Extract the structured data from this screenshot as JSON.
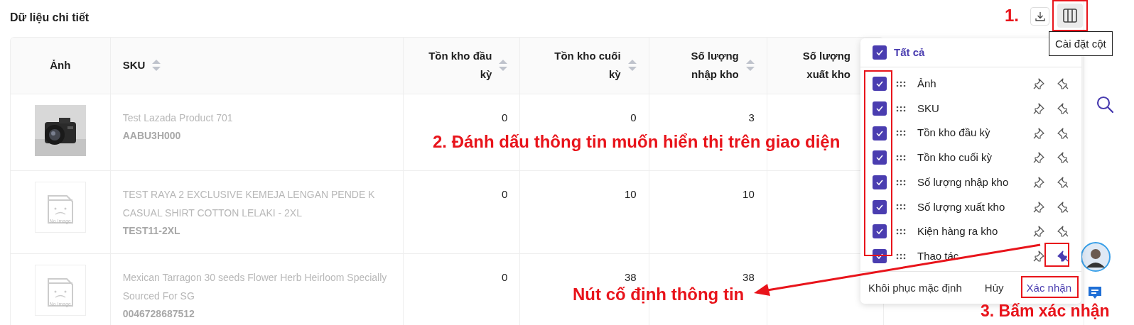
{
  "title": "Dữ liệu chi tiết",
  "tooltip": "Cài đặt cột",
  "table": {
    "columns": [
      {
        "label": "Ảnh",
        "sortable": false
      },
      {
        "label": "SKU",
        "sortable": true
      },
      {
        "label": "Tồn kho đầu kỳ",
        "sortable": true
      },
      {
        "label": "Tồn kho cuối kỳ",
        "sortable": true
      },
      {
        "label": "Số lượng nhập kho",
        "sortable": true
      },
      {
        "label": "Số lượng xuất kho",
        "sortable": false
      }
    ],
    "rows": [
      {
        "name": "Test Lazada Product 701",
        "sku": "AABU3H000",
        "opening_stock": "0",
        "closing_stock": "0",
        "stock_in": "3"
      },
      {
        "image": {
          "kind": "placeholder",
          "label": "No Image"
        },
        "name": "TEST RAYA 2 EXCLUSIVE KEMEJA LENGAN PENDE K CASUAL SHIRT COTTON LELAKI - 2XL",
        "sku": "TEST11-2XL",
        "opening_stock": "0",
        "closing_stock": "10",
        "stock_in": "10"
      },
      {
        "image": {
          "kind": "placeholder",
          "label": "No Image"
        },
        "name": "Mexican Tarragon 30 seeds Flower Herb Heirloom Specially Sourced For SG",
        "sku": "0046728687512",
        "opening_stock": "0",
        "closing_stock": "38",
        "stock_in": "38"
      }
    ]
  },
  "column_settings": {
    "select_all": {
      "label": "Tất cả",
      "checked": true
    },
    "items": [
      {
        "label": "Ảnh",
        "checked": true,
        "pinned_left": false,
        "pinned_right": false
      },
      {
        "label": "SKU",
        "checked": true,
        "pinned_left": false,
        "pinned_right": false
      },
      {
        "label": "Tồn kho đầu kỳ",
        "checked": true,
        "pinned_left": false,
        "pinned_right": false
      },
      {
        "label": "Tồn kho cuối kỳ",
        "checked": true,
        "pinned_left": false,
        "pinned_right": false
      },
      {
        "label": "Số lượng nhập kho",
        "checked": true,
        "pinned_left": false,
        "pinned_right": false
      },
      {
        "label": "Số lượng xuất kho",
        "checked": true,
        "pinned_left": false,
        "pinned_right": false
      },
      {
        "label": "Kiện hàng ra kho",
        "checked": true,
        "pinned_left": false,
        "pinned_right": false
      },
      {
        "label": "Thao tác",
        "checked": true,
        "pinned_left": false,
        "pinned_right": true
      }
    ],
    "buttons": [
      {
        "label": "Khôi phục mặc định",
        "kind": "plain"
      },
      {
        "label": "Hủy",
        "kind": "plain"
      },
      {
        "label": "Xác nhận",
        "kind": "primary"
      }
    ]
  },
  "annotations": [
    "1.",
    "2. Đánh dấu thông tin muốn hiển thị trên giao diện",
    "Nút cố định thông tin",
    "3. Bấm xác nhận"
  ]
}
